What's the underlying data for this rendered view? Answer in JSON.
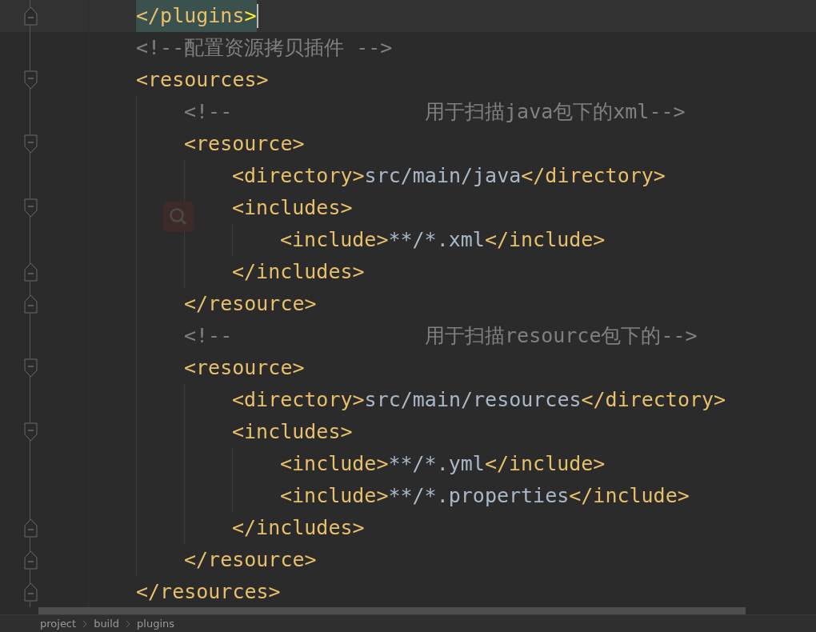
{
  "editor": {
    "lines": [
      {
        "kind": "fold-end",
        "selected": true,
        "tokens": [
          {
            "kind": "tag",
            "text": "</plugins"
          },
          {
            "kind": "match",
            "text": ">"
          }
        ]
      },
      {
        "selected": false,
        "tokens": [
          {
            "kind": "comment",
            "text": "<!--配置资源拷贝插件 -->"
          }
        ]
      },
      {
        "kind": "fold-start",
        "selected": false,
        "tokens": [
          {
            "kind": "tag",
            "text": "<resources>"
          }
        ],
        "children": [
          {
            "selected": false,
            "tokens": [
              {
                "kind": "comment",
                "text": "<!--                用于扫描java包下的xml-->"
              }
            ]
          },
          {
            "kind": "fold-start",
            "selected": false,
            "tokens": [
              {
                "kind": "tag",
                "text": "<resource>"
              }
            ],
            "children": [
              {
                "selected": false,
                "tokens": [
                  {
                    "kind": "tag",
                    "text": "<directory>"
                  },
                  {
                    "kind": "text",
                    "text": "src/main/java"
                  },
                  {
                    "kind": "tag",
                    "text": "</directory>"
                  }
                ]
              },
              {
                "kind": "fold-start",
                "selected": false,
                "tokens": [
                  {
                    "kind": "tag",
                    "text": "<includes>"
                  }
                ],
                "children": [
                  {
                    "selected": false,
                    "tokens": [
                      {
                        "kind": "tag",
                        "text": "<include>"
                      },
                      {
                        "kind": "text",
                        "text": "**/*.xml"
                      },
                      {
                        "kind": "tag",
                        "text": "</include>"
                      }
                    ]
                  }
                ]
              },
              {
                "kind": "fold-end",
                "selected": false,
                "tokens": [
                  {
                    "kind": "tag",
                    "text": "</includes>"
                  }
                ]
              }
            ]
          },
          {
            "kind": "fold-end",
            "selected": false,
            "tokens": [
              {
                "kind": "tag",
                "text": "</resource>"
              }
            ]
          },
          {
            "selected": false,
            "tokens": [
              {
                "kind": "comment",
                "text": "<!--                用于扫描resource包下的-->"
              }
            ]
          },
          {
            "kind": "fold-start",
            "selected": false,
            "tokens": [
              {
                "kind": "tag",
                "text": "<resource>"
              }
            ],
            "children": [
              {
                "selected": false,
                "tokens": [
                  {
                    "kind": "tag",
                    "text": "<directory>"
                  },
                  {
                    "kind": "text",
                    "text": "src/main/resources"
                  },
                  {
                    "kind": "tag",
                    "text": "</directory>"
                  }
                ]
              },
              {
                "kind": "fold-start",
                "selected": false,
                "tokens": [
                  {
                    "kind": "tag",
                    "text": "<includes>"
                  }
                ],
                "children": [
                  {
                    "selected": false,
                    "tokens": [
                      {
                        "kind": "tag",
                        "text": "<include>"
                      },
                      {
                        "kind": "text",
                        "text": "**/*.yml"
                      },
                      {
                        "kind": "tag",
                        "text": "</include>"
                      }
                    ]
                  },
                  {
                    "selected": false,
                    "tokens": [
                      {
                        "kind": "tag",
                        "text": "<include>"
                      },
                      {
                        "kind": "text",
                        "text": "**/*.properties"
                      },
                      {
                        "kind": "tag",
                        "text": "</include>"
                      }
                    ]
                  }
                ]
              },
              {
                "kind": "fold-end",
                "selected": false,
                "tokens": [
                  {
                    "kind": "tag",
                    "text": "</includes>"
                  }
                ]
              }
            ]
          },
          {
            "kind": "fold-end",
            "selected": false,
            "tokens": [
              {
                "kind": "tag",
                "text": "</resource>"
              }
            ]
          }
        ]
      },
      {
        "kind": "fold-end",
        "selected": false,
        "tokens": [
          {
            "kind": "tag",
            "text": "</resources>"
          }
        ]
      }
    ]
  },
  "breadcrumb": [
    "project",
    "build",
    "plugins"
  ]
}
